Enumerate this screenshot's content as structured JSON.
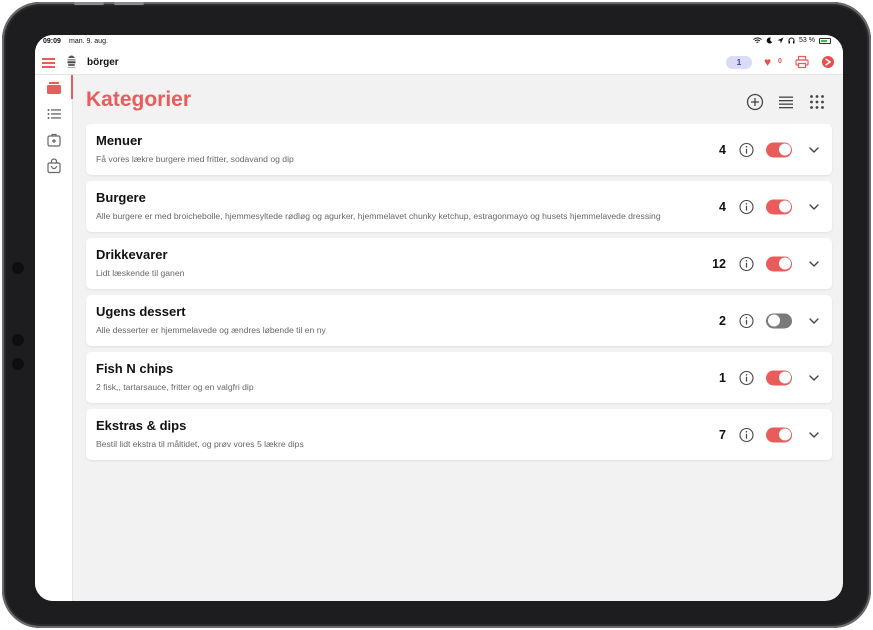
{
  "status_bar": {
    "time": "09:09",
    "date": "man. 9. aug.",
    "battery": "53 %"
  },
  "header": {
    "shop_name": "börger",
    "order_badge": "1",
    "favorites_count": "0"
  },
  "page": {
    "title": "Kategorier"
  },
  "categories": [
    {
      "name": "Menuer",
      "description": "Få vores lækre burgere med fritter, sodavand og dip",
      "count": "4",
      "enabled": true
    },
    {
      "name": "Burgere",
      "description": "Alle burgere er med broichebolle, hjemmesyltede rødløg og agurker, hjemmelavet chunky ketchup, estragonmayo og husets hjemmelavede dressing",
      "count": "4",
      "enabled": true
    },
    {
      "name": "Drikkevarer",
      "description": "Lidt læskende til ganen",
      "count": "12",
      "enabled": true
    },
    {
      "name": "Ugens dessert",
      "description": "Alle desserter er hjemmelavede og ændres løbende til en ny",
      "count": "2",
      "enabled": false
    },
    {
      "name": "Fish N chips",
      "description": "2 fisk,, tartarsauce, fritter og en valgfri dip",
      "count": "1",
      "enabled": true
    },
    {
      "name": "Ekstras & dips",
      "description": "Bestil lidt ekstra til måltidet, og prøv vores 5 lækre dips",
      "count": "7",
      "enabled": true
    }
  ],
  "colors": {
    "accent": "#e85c5c",
    "toggle_off": "#7a7a7a",
    "badge_bg": "#d9dbf7",
    "background": "#f2f2f2"
  },
  "icons": {
    "menu": "hamburger-menu-icon",
    "favorites": "heart-icon",
    "print": "printer-icon",
    "logout": "power-icon",
    "add": "plus-circle-icon",
    "list_view": "list-view-icon",
    "grid_view": "grid-view-icon",
    "info": "info-icon",
    "expand": "chevron-down-icon"
  }
}
